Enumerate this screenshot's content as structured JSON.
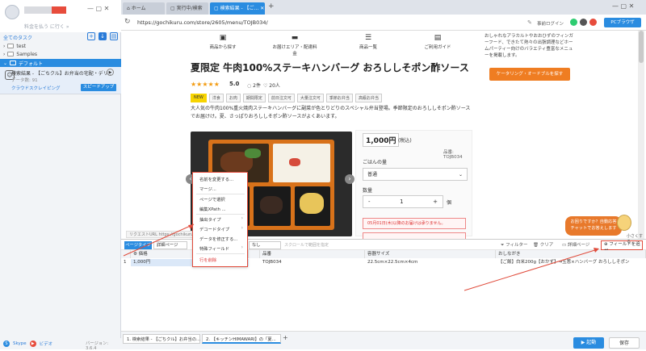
{
  "left": {
    "upgrade": "料金を払う に行く »",
    "all_tasks": "全てのタスク",
    "tree": [
      "test",
      "Samples"
    ],
    "default_group": "デフォルト",
    "task": {
      "title": "検索結果 - 【ごちクル】お弁当の宅配・デリ...",
      "meta": "データ数: 91",
      "cloud_link": "クラウドスクレイピング",
      "speedup": "スピードアップ"
    },
    "footer": {
      "skype": "Skype",
      "video": "ビデオ",
      "version": "バージョン: 3.6.4"
    }
  },
  "tabs": [
    "ホーム",
    "実行中/検索",
    "検索結果 - 【ご..."
  ],
  "address": {
    "url": "https://gochikuru.com/store/2605/menu/TOJB034/",
    "login": "事前ログイン",
    "browser": "PCブラウザ"
  },
  "web": {
    "nav": [
      {
        "icon": "▣",
        "label": "商品から探す"
      },
      {
        "icon": "▬",
        "label": "お届けエリア・配達料金"
      },
      {
        "icon": "☰",
        "label": "商品一覧"
      },
      {
        "icon": "▤",
        "label": "ご利用ガイド"
      }
    ],
    "side_ad": "おしゃれなアラカルトやおおひずのフィンガーフード、できたて熱々の出張調理などホームパーティー向けのバラエティ豊富なメニューを掲載します。",
    "side_button": "ケータリング・オードブルを探す",
    "title": "夏限定 牛肉100%ステーキハンバーグ おろししそポン酢ソース",
    "stars": "★★★★★",
    "rating": "5.0",
    "reviews": "2件",
    "likes": "♡ 20人",
    "tags": [
      "NEW",
      "洋食",
      "お肉",
      "期間限定",
      "前日注文可",
      "大量注文可",
      "季節お弁当",
      "高級お弁当"
    ],
    "description": "大人気の牛肉100%重火焼肉ステーキハンバーグに副菜が色とりどりのスペシャル弁当登場。季節限定のおろししそポン酢ソースでお届けけ。夏、さっぱりおろししそポン酢ソースがよくあいます。",
    "price": "1,000円",
    "price_tax": "(税込)",
    "sku": "品番: TOJB034",
    "rice_label": "ごはんの量",
    "rice_value": "普通",
    "qty_label": "数量",
    "qty_minus": "-",
    "qty_value": "1",
    "qty_plus": "+",
    "qty_unit": "個",
    "alert": "05月01日(木)以降のお届けは承りません。"
  },
  "context_menu": {
    "items": [
      "名前を変更する...",
      "マージ...",
      "ページで選択",
      "編集XPath ...",
      "抽出タイプ",
      "デコードタイプ",
      "データを修正する...",
      "特殊フィールド",
      "行を削除"
    ]
  },
  "hint": {
    "text1": "お困りですか？自動応答",
    "text2": "チャットでお答えします",
    "minimize": "小さくする"
  },
  "toolstrip": {
    "page_type": "ページタイプ",
    "page_dropdown": "詳細ページ",
    "url_chip": "リクエストURL https://gochikuru.com/collect",
    "dropdown2": "なし",
    "scroll_hint": "スクロールで範囲を指定",
    "filter": "フィルター",
    "clear": "クリア",
    "preview": "詳細ページ",
    "add_field": "フィールドを追加"
  },
  "table": {
    "headers": [
      "",
      "価格",
      "",
      "品番",
      "容器サイズ",
      "おしながき"
    ],
    "row": [
      "1",
      "1,000円",
      "",
      "TOJB034",
      "22.5cm×22.5cm×4cm",
      "【ご飯】白米200g【おかず】→玉葱×ハンバーグ おろししそポン"
    ]
  },
  "bottom": {
    "tabs": [
      "1. 検索結果 - 【ごちクル】お弁当の...",
      "2. 【キッチンHIMAWARI】の「夏..."
    ],
    "run": "▶ 起動",
    "save": "保存"
  }
}
